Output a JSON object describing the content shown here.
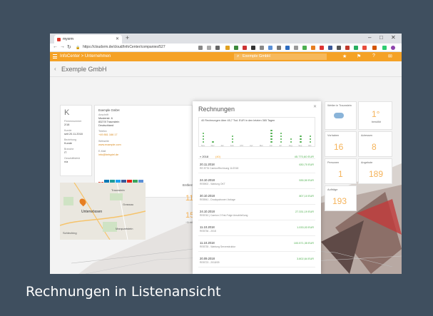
{
  "caption": "Rechnungen in Listenansicht",
  "browser": {
    "tab_title": "myxrm",
    "url": "https://cloudxrm.de/cloud/InfoCenter/companies/527",
    "new_tab": "+",
    "min": "–",
    "max": "□",
    "close": "✕"
  },
  "app": {
    "breadcrumb": "InfoCenter > Unternehmen",
    "search_value": "Exemple GmbH",
    "page_title": "Exemple GmbH"
  },
  "company": {
    "initial": "K",
    "created_label": "Firmennummer",
    "created_value": "2/18",
    "date_label": "Kunde",
    "date_value": "seit 20.11.2018",
    "rel_label": "Beziehung",
    "rel_value": "Kunde",
    "branch_label": "Branche",
    "branch_value": "IT",
    "business_label": "Geschäftsfeld",
    "business_value": "n/a",
    "name": "Exemple GmbH",
    "address_label": "Anschrift",
    "address_line1": "Musterstr. 6",
    "address_line2": "83278 Traunstein",
    "address_line3": "Deutschland",
    "phone_label": "Telefon",
    "phone_value": "+49 861 166 17",
    "web_label": "Webseite",
    "web_value": "www.example.com",
    "email_label": "E-Mail",
    "email_value": "info@beispiel.de",
    "social_icons": [
      "google-icon",
      "linkedin-icon",
      "xing-icon",
      "twitter-icon",
      "facebook-icon",
      "youtube-icon",
      "rss-icon",
      "mail-icon"
    ]
  },
  "map": {
    "city": "Unterwössen",
    "place2": "Marquartstein",
    "place3": "Grassau",
    "place4": "Traunstein",
    "place5": "Schleching"
  },
  "distance": {
    "label": "Entfernung",
    "km": "11,0 km",
    "sep": "–",
    "minutes": "15 min",
    "sub": "~5 min"
  },
  "rechnungen": {
    "title": "Rechnungen",
    "chart_caption": "40 Rechnungen über 45,7 Tsd. EUR in den letzten 365 Tagen",
    "year_label": "» 2018",
    "year_count": "(40)",
    "year_total": "45.770,60 EUR",
    "rows": [
      {
        "date": "20.11.2018",
        "desc": "RE 8776 CamionRechnung 11/2018",
        "amount": "630,70 EUR"
      },
      {
        "date": "24.10.2018",
        "desc": "RE8902 - Wartung OKT",
        "amount": "535,50 EUR"
      },
      {
        "date": "30.10.2018",
        "desc": "RE8941 - Druckpatronen Vorlage",
        "amount": "807,10 EUR"
      },
      {
        "date": "24.10.2018",
        "desc": "RE8740 | Camion 2 Erst-Folge Anschließung",
        "amount": "27.331,19 EUR"
      },
      {
        "date": "11.10.2018",
        "desc": "RE8736 - 2018",
        "amount": "1.033,03 EUR"
      },
      {
        "date": "11.10.2018",
        "desc": "RE8735 - Wartung Serverstruktur",
        "amount": "100.571,35 EUR"
      },
      {
        "date": "20.09.2018",
        "desc": "RE8723 - 2018/09",
        "amount": "3.802,64 EUR"
      }
    ]
  },
  "chart_data": {
    "type": "scatter",
    "caption": "40 Rechnungen über 45,7 Tsd. EUR in den letzten 365 Tagen",
    "x_labels": [
      "Nov",
      "Dez",
      "Jan",
      "Feb",
      "Mrz",
      "Apr",
      "Mai",
      "Jun",
      "Jul",
      "Aug",
      "Sep",
      "Okt"
    ],
    "counts_per_month": [
      4,
      1,
      0,
      3,
      0,
      0,
      0,
      5,
      4,
      2,
      3,
      3
    ]
  },
  "weather": {
    "label": "Wetter in Traunstein",
    "temp": "1°",
    "desc": "bewölkt"
  },
  "stats": {
    "projects_label": "Vorhaben",
    "projects": "16",
    "addresses_label": "Adressen",
    "addresses": "8",
    "persons_label": "Personen",
    "persons": "1",
    "offers_label": "Angebote",
    "offers": "189",
    "orders_label": "Aufträge",
    "orders": "193"
  },
  "colors": {
    "accent": "#f5a226",
    "background": "#3f4f5f",
    "green": "#4cae4c"
  }
}
